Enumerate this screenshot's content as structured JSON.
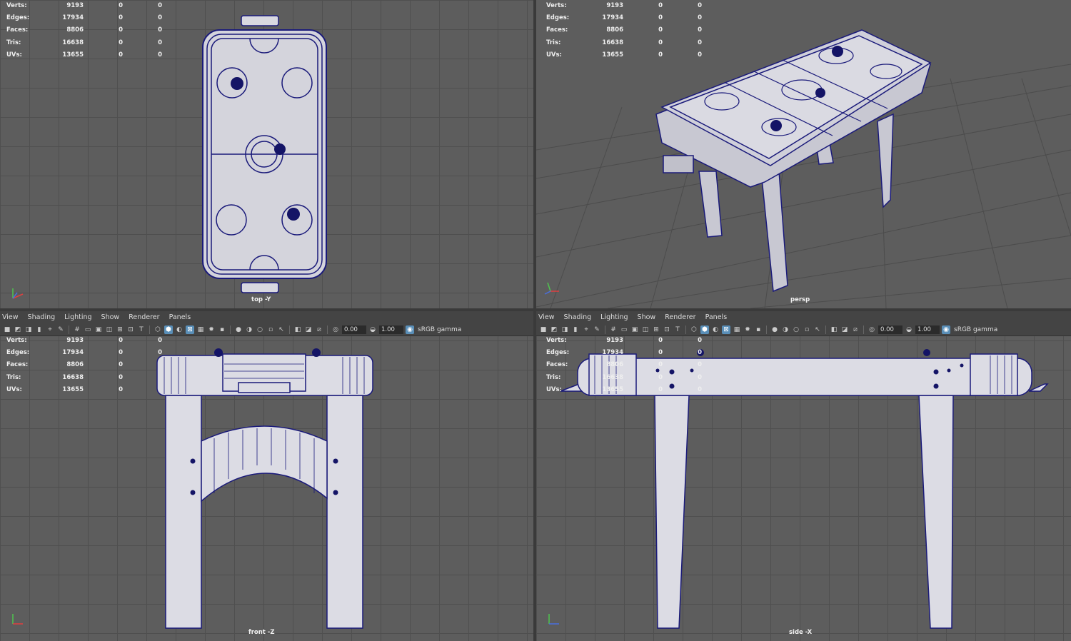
{
  "hud": {
    "rows": [
      {
        "label": "Verts:",
        "v1": "9193",
        "v2": "0",
        "v3": "0"
      },
      {
        "label": "Edges:",
        "v1": "17934",
        "v2": "0",
        "v3": "0"
      },
      {
        "label": "Faces:",
        "v1": "8806",
        "v2": "0",
        "v3": "0"
      },
      {
        "label": "Tris:",
        "v1": "16638",
        "v2": "0",
        "v3": "0"
      },
      {
        "label": "UVs:",
        "v1": "13655",
        "v2": "0",
        "v3": "0"
      }
    ]
  },
  "menu": [
    "View",
    "Shading",
    "Lighting",
    "Show",
    "Renderer",
    "Panels"
  ],
  "toolbar": {
    "exposure": "0.00",
    "gamma": "1.00",
    "color_space": "sRGB gamma"
  },
  "viewports": {
    "top": "top -Y",
    "persp": "persp",
    "front": "front -Z",
    "side": "side -X"
  },
  "colors": {
    "viewport_bg": "#5d5d5d",
    "grid": "#4f4f4f",
    "wire": "#1a1a7a",
    "model_fill": "#dcdce4"
  }
}
